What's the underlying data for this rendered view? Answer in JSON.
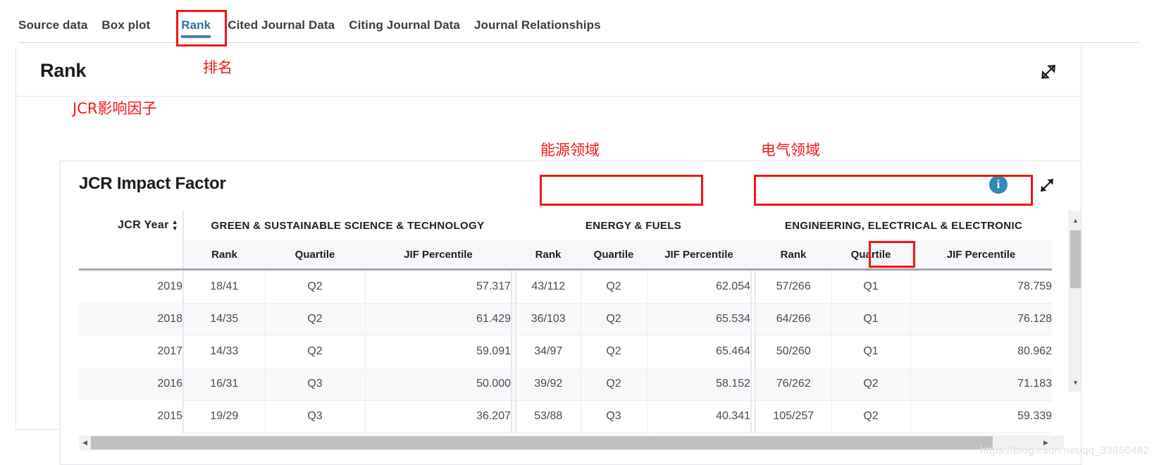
{
  "tabs": [
    {
      "label": "Source data",
      "active": false
    },
    {
      "label": "Box plot",
      "active": false
    },
    {
      "label": "Rank",
      "active": true
    },
    {
      "label": "Cited Journal Data",
      "active": false
    },
    {
      "label": "Citing Journal Data",
      "active": false
    },
    {
      "label": "Journal Relationships",
      "active": false
    }
  ],
  "rank_panel": {
    "title": "Rank",
    "expand_icon": "expand-icon"
  },
  "jcr_card": {
    "title": "JCR Impact Factor",
    "info_icon": "i",
    "expand_icon": "expand-icon"
  },
  "annotations": [
    {
      "text": "排名",
      "meaning": "rank"
    },
    {
      "text": "JCR影响因子",
      "meaning": "jcr-impact-factor"
    },
    {
      "text": "能源领域",
      "meaning": "energy-field"
    },
    {
      "text": "电气领域",
      "meaning": "electrical-field"
    }
  ],
  "table": {
    "year_column": {
      "label": "JCR Year",
      "sortable": true
    },
    "groups": [
      {
        "name": "GREEN & SUSTAINABLE SCIENCE & TECHNOLOGY",
        "highlighted": false
      },
      {
        "name": "ENERGY & FUELS",
        "highlighted": true
      },
      {
        "name": "ENGINEERING, ELECTRICAL & ELECTRONIC",
        "highlighted": true
      }
    ],
    "subheaders": [
      "Rank",
      "Quartile",
      "JIF Percentile"
    ],
    "rows": [
      {
        "year": "2019",
        "g1": {
          "rank": "18/41",
          "quartile": "Q2",
          "pct": "57.317"
        },
        "g2": {
          "rank": "43/112",
          "quartile": "Q2",
          "pct": "62.054"
        },
        "g3": {
          "rank": "57/266",
          "quartile": "Q1",
          "pct": "78.759",
          "quartile_highlighted": true
        }
      },
      {
        "year": "2018",
        "g1": {
          "rank": "14/35",
          "quartile": "Q2",
          "pct": "61.429"
        },
        "g2": {
          "rank": "36/103",
          "quartile": "Q2",
          "pct": "65.534"
        },
        "g3": {
          "rank": "64/266",
          "quartile": "Q1",
          "pct": "76.128"
        }
      },
      {
        "year": "2017",
        "g1": {
          "rank": "14/33",
          "quartile": "Q2",
          "pct": "59.091"
        },
        "g2": {
          "rank": "34/97",
          "quartile": "Q2",
          "pct": "65.464"
        },
        "g3": {
          "rank": "50/260",
          "quartile": "Q1",
          "pct": "80.962"
        }
      },
      {
        "year": "2016",
        "g1": {
          "rank": "16/31",
          "quartile": "Q3",
          "pct": "50.000"
        },
        "g2": {
          "rank": "39/92",
          "quartile": "Q2",
          "pct": "58.152"
        },
        "g3": {
          "rank": "76/262",
          "quartile": "Q2",
          "pct": "71.183"
        }
      },
      {
        "year": "2015",
        "g1": {
          "rank": "19/29",
          "quartile": "Q3",
          "pct": "36.207"
        },
        "g2": {
          "rank": "53/88",
          "quartile": "Q3",
          "pct": "40.341"
        },
        "g3": {
          "rank": "105/257",
          "quartile": "Q2",
          "pct": "59.339"
        }
      }
    ]
  },
  "scrollbars": {
    "vertical_up": "▲",
    "vertical_down": "▼",
    "horizontal_left": "◀",
    "horizontal_right": "▶"
  },
  "watermark": "https://blog.csdn.net/qq_33850482",
  "colors": {
    "accent_tab": "#2f6fa8",
    "annotation_red": "#f41515",
    "info_blue": "#2e8ab8"
  }
}
